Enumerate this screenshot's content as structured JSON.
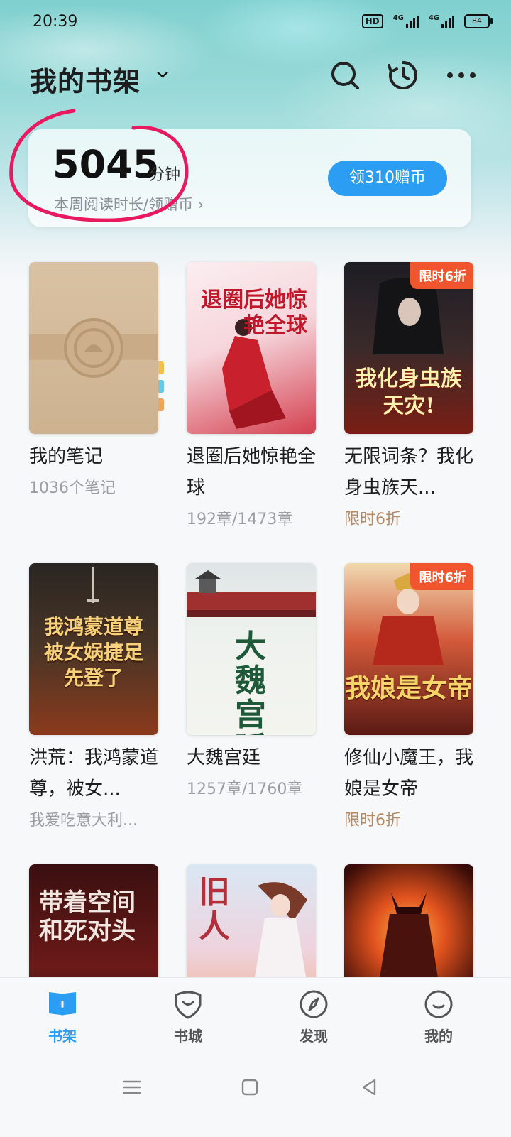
{
  "status_bar": {
    "time": "20:39",
    "network_badge": "HD",
    "signal1_label": "4G",
    "signal2_label": "4G",
    "battery": "84"
  },
  "header": {
    "title": "我的书架",
    "icons": [
      "chevron-down-icon",
      "search-icon",
      "history-icon",
      "more-icon"
    ]
  },
  "reading": {
    "minutes": "5045",
    "unit": "分钟",
    "subtitle": "本周阅读时长/领赠币 ›",
    "claim_label": "领310赠币"
  },
  "books": [
    {
      "title": "我的笔记",
      "sub": "1036个笔记",
      "promo": "",
      "cover_text": ""
    },
    {
      "title": "退圈后她惊艳全球",
      "sub": "192章/1473章",
      "promo": "",
      "cover_text": "退圈后她惊艳全球"
    },
    {
      "title": "无限词条？我化身虫族天...",
      "sub": "限时6折",
      "promo": "限时6折",
      "cover_text": "我化身虫族天灾!"
    },
    {
      "title": "洪荒：我鸿蒙道尊，被女...",
      "sub": "我爱吃意大利...",
      "promo": "",
      "cover_text": "我鸿蒙道尊 被女娲捷足先登了"
    },
    {
      "title": "大魏宫廷",
      "sub": "1257章/1760章",
      "promo": "",
      "cover_text": "大魏宫廷"
    },
    {
      "title": "修仙小魔王，我娘是女帝",
      "sub": "限时6折",
      "promo": "限时6折",
      "cover_text": "我娘是女帝"
    },
    {
      "title": "",
      "sub": "",
      "promo": "",
      "cover_text": "带着空间和死对头"
    },
    {
      "title": "",
      "sub": "",
      "promo": "",
      "cover_text": "旧人"
    },
    {
      "title": "",
      "sub": "",
      "promo": "",
      "cover_text": ""
    }
  ],
  "bottom_nav": [
    {
      "label": "书架",
      "icon": "bookshelf-icon",
      "active": true
    },
    {
      "label": "书城",
      "icon": "bookstore-icon",
      "active": false
    },
    {
      "label": "发现",
      "icon": "discover-icon",
      "active": false
    },
    {
      "label": "我的",
      "icon": "profile-icon",
      "active": false
    }
  ],
  "system_nav": [
    "menu-icon",
    "home-icon",
    "back-icon"
  ],
  "colors": {
    "accent": "#2b9df2",
    "promo": "#f0562e",
    "promo_text": "#b58a66",
    "annotation": "#e8195f"
  }
}
